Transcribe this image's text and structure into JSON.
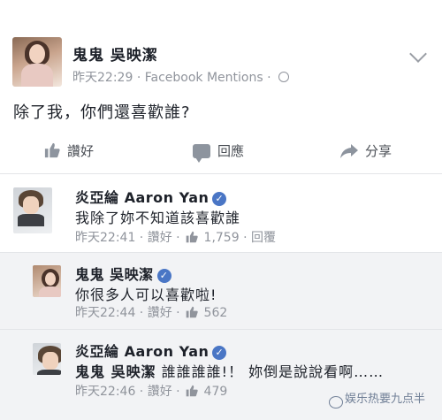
{
  "post": {
    "author": "鬼鬼 吳映潔",
    "time": "昨天22:29",
    "source": "Facebook Mentions",
    "separator": "·",
    "text": "除了我，你們還喜歡誰?"
  },
  "actions": {
    "like": "讚好",
    "comment": "回應",
    "share": "分享"
  },
  "comments": [
    {
      "name": "炎亞綸 Aaron Yan",
      "text": "我除了妳不知道該喜歡誰",
      "time": "昨天22:41",
      "like_label": "讚好",
      "likes": "1,759",
      "reply": "回覆"
    },
    {
      "name": "鬼鬼 吳映潔",
      "text": "你很多人可以喜歡啦!",
      "time": "昨天22:44",
      "like_label": "讚好",
      "likes": "562"
    },
    {
      "name": "炎亞綸 Aaron Yan",
      "mention": "鬼鬼 吳映潔",
      "text": "誰誰誰誰!！ 妳倒是說說看啊……",
      "time": "昨天22:46",
      "like_label": "讚好",
      "likes": "479"
    }
  ],
  "watermark": "娱乐热要九点半",
  "icons": {
    "verified": "verified-badge-icon",
    "globe": "globe-icon",
    "chevron": "chevron-down-icon",
    "like": "thumbs-up-icon",
    "comment": "comment-bubble-icon",
    "share": "share-arrow-icon"
  },
  "colors": {
    "verified": "#4a76c5",
    "meta": "#90949c",
    "comment_bg": "#f2f3f5"
  }
}
